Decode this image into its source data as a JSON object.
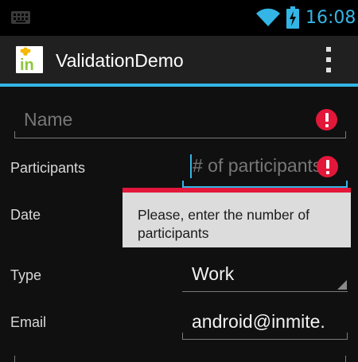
{
  "status_bar": {
    "time": "16:08",
    "icons": [
      "keyboard-icon",
      "wifi-icon",
      "battery-charging-icon"
    ],
    "accent_color": "#33b5e5"
  },
  "action_bar": {
    "title": "ValidationDemo",
    "logo_text": "in",
    "overflow_icon": "overflow-menu-icon"
  },
  "form": {
    "name": {
      "placeholder": "Name",
      "value": "",
      "has_error": true
    },
    "participants": {
      "label": "Participants",
      "placeholder": "# of participants",
      "value": "",
      "has_error": true,
      "focused": true
    },
    "date": {
      "label": "Date",
      "value": "",
      "has_error": true
    },
    "type": {
      "label": "Type",
      "selected": "Work"
    },
    "email": {
      "label": "Email",
      "value": "android@inmite."
    }
  },
  "error_popup": {
    "message": "Please, enter the number of participants"
  },
  "colors": {
    "error": "#e3173a",
    "accent": "#33b5e5",
    "popup_background": "#dcdcdc"
  }
}
